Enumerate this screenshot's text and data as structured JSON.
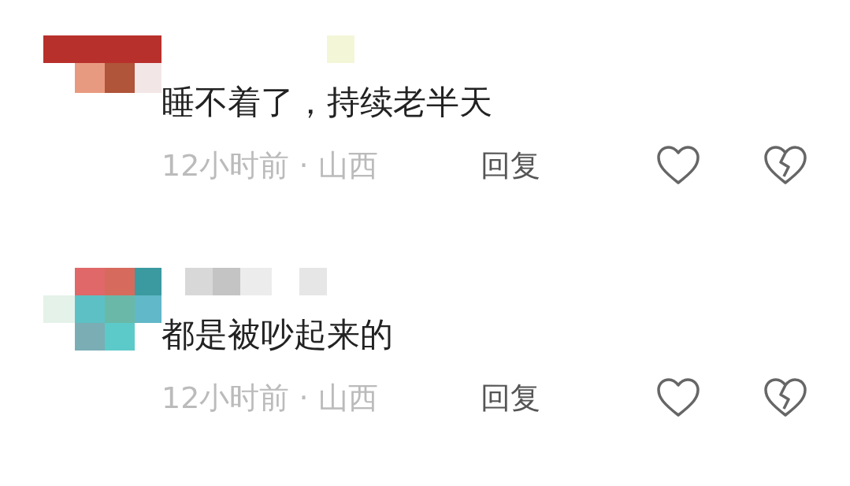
{
  "comments": [
    {
      "text": "睡不着了，持续老半天",
      "meta": "12小时前 · 山西",
      "reply": "回复"
    },
    {
      "text": "都是被吵起来的",
      "meta": "12小时前 · 山西",
      "reply": "回复"
    }
  ]
}
